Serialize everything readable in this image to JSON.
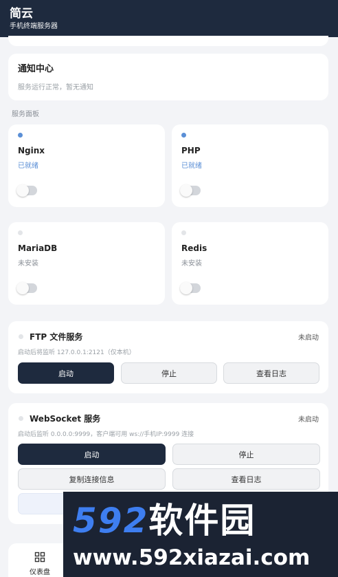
{
  "header": {
    "title": "简云",
    "subtitle": "手机终端服务器"
  },
  "notice": {
    "title": "通知中心",
    "text": "服务运行正常，暂无通知"
  },
  "section_label": "服务面板",
  "services": [
    {
      "name": "Nginx",
      "status": "已就绪",
      "enabled": false
    },
    {
      "name": "PHP",
      "status": "已就绪",
      "enabled": false
    },
    {
      "name": "MariaDB",
      "status": "未安装",
      "enabled": false
    },
    {
      "name": "Redis",
      "status": "未安装",
      "enabled": false
    }
  ],
  "ftp": {
    "title": "FTP 文件服务",
    "status": "未启动",
    "desc": "启动后将监听 127.0.0.1:2121（仅本机）",
    "buttons": {
      "start": "启动",
      "stop": "停止",
      "logs": "查看日志"
    }
  },
  "websocket": {
    "title": "WebSocket 服务",
    "status": "未启动",
    "desc": "启动后监听 0.0.0.0:9999，客户端可用 ws://手机IP:9999 连接",
    "buttons": {
      "start": "启动",
      "stop": "停止",
      "copy": "复制连接信息",
      "logs": "查看日志"
    }
  },
  "nav": {
    "dashboard_label": "仪表盘"
  },
  "watermark": {
    "logo_digits": "592",
    "logo_text": "软件园",
    "url": "www.592xiazai.com"
  },
  "colors": {
    "header_bg": "#1e2a3e",
    "primary_button": "#1e2a3e",
    "ready_accent": "#5b8fd6",
    "watermark_blue": "#3e7ef0"
  }
}
